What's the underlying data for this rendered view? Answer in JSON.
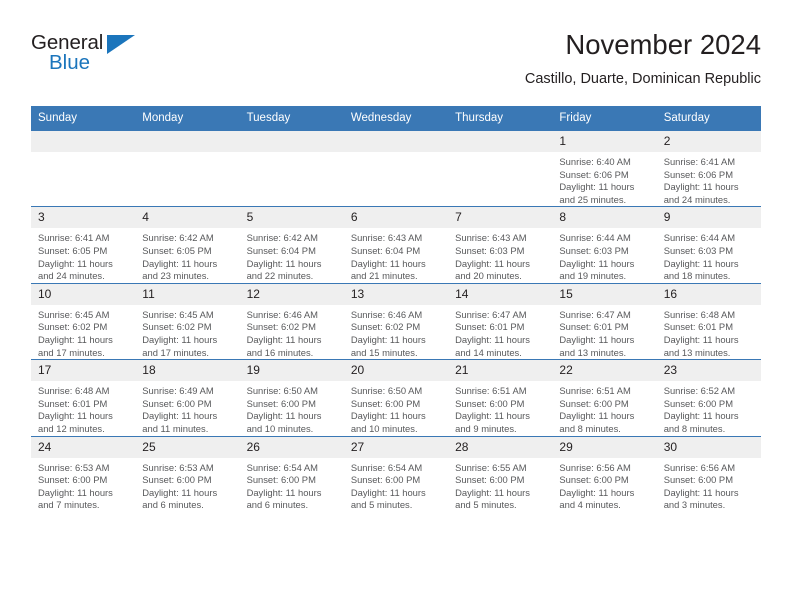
{
  "brand": {
    "name_part1": "General",
    "name_part2": "Blue",
    "triangle_icon": "triangle-icon"
  },
  "header": {
    "title": "November 2024",
    "subtitle": "Castillo, Duarte, Dominican Republic",
    "accent_color": "#3a78b5",
    "brand_blue": "#1b75bc"
  },
  "calendar": {
    "weekday_headers": [
      "Sunday",
      "Monday",
      "Tuesday",
      "Wednesday",
      "Thursday",
      "Friday",
      "Saturday"
    ],
    "weeks": [
      [
        {
          "day": "",
          "info": ""
        },
        {
          "day": "",
          "info": ""
        },
        {
          "day": "",
          "info": ""
        },
        {
          "day": "",
          "info": ""
        },
        {
          "day": "",
          "info": ""
        },
        {
          "day": "1",
          "info": "Sunrise: 6:40 AM\nSunset: 6:06 PM\nDaylight: 11 hours and 25 minutes."
        },
        {
          "day": "2",
          "info": "Sunrise: 6:41 AM\nSunset: 6:06 PM\nDaylight: 11 hours and 24 minutes."
        }
      ],
      [
        {
          "day": "3",
          "info": "Sunrise: 6:41 AM\nSunset: 6:05 PM\nDaylight: 11 hours and 24 minutes."
        },
        {
          "day": "4",
          "info": "Sunrise: 6:42 AM\nSunset: 6:05 PM\nDaylight: 11 hours and 23 minutes."
        },
        {
          "day": "5",
          "info": "Sunrise: 6:42 AM\nSunset: 6:04 PM\nDaylight: 11 hours and 22 minutes."
        },
        {
          "day": "6",
          "info": "Sunrise: 6:43 AM\nSunset: 6:04 PM\nDaylight: 11 hours and 21 minutes."
        },
        {
          "day": "7",
          "info": "Sunrise: 6:43 AM\nSunset: 6:03 PM\nDaylight: 11 hours and 20 minutes."
        },
        {
          "day": "8",
          "info": "Sunrise: 6:44 AM\nSunset: 6:03 PM\nDaylight: 11 hours and 19 minutes."
        },
        {
          "day": "9",
          "info": "Sunrise: 6:44 AM\nSunset: 6:03 PM\nDaylight: 11 hours and 18 minutes."
        }
      ],
      [
        {
          "day": "10",
          "info": "Sunrise: 6:45 AM\nSunset: 6:02 PM\nDaylight: 11 hours and 17 minutes."
        },
        {
          "day": "11",
          "info": "Sunrise: 6:45 AM\nSunset: 6:02 PM\nDaylight: 11 hours and 17 minutes."
        },
        {
          "day": "12",
          "info": "Sunrise: 6:46 AM\nSunset: 6:02 PM\nDaylight: 11 hours and 16 minutes."
        },
        {
          "day": "13",
          "info": "Sunrise: 6:46 AM\nSunset: 6:02 PM\nDaylight: 11 hours and 15 minutes."
        },
        {
          "day": "14",
          "info": "Sunrise: 6:47 AM\nSunset: 6:01 PM\nDaylight: 11 hours and 14 minutes."
        },
        {
          "day": "15",
          "info": "Sunrise: 6:47 AM\nSunset: 6:01 PM\nDaylight: 11 hours and 13 minutes."
        },
        {
          "day": "16",
          "info": "Sunrise: 6:48 AM\nSunset: 6:01 PM\nDaylight: 11 hours and 13 minutes."
        }
      ],
      [
        {
          "day": "17",
          "info": "Sunrise: 6:48 AM\nSunset: 6:01 PM\nDaylight: 11 hours and 12 minutes."
        },
        {
          "day": "18",
          "info": "Sunrise: 6:49 AM\nSunset: 6:00 PM\nDaylight: 11 hours and 11 minutes."
        },
        {
          "day": "19",
          "info": "Sunrise: 6:50 AM\nSunset: 6:00 PM\nDaylight: 11 hours and 10 minutes."
        },
        {
          "day": "20",
          "info": "Sunrise: 6:50 AM\nSunset: 6:00 PM\nDaylight: 11 hours and 10 minutes."
        },
        {
          "day": "21",
          "info": "Sunrise: 6:51 AM\nSunset: 6:00 PM\nDaylight: 11 hours and 9 minutes."
        },
        {
          "day": "22",
          "info": "Sunrise: 6:51 AM\nSunset: 6:00 PM\nDaylight: 11 hours and 8 minutes."
        },
        {
          "day": "23",
          "info": "Sunrise: 6:52 AM\nSunset: 6:00 PM\nDaylight: 11 hours and 8 minutes."
        }
      ],
      [
        {
          "day": "24",
          "info": "Sunrise: 6:53 AM\nSunset: 6:00 PM\nDaylight: 11 hours and 7 minutes."
        },
        {
          "day": "25",
          "info": "Sunrise: 6:53 AM\nSunset: 6:00 PM\nDaylight: 11 hours and 6 minutes."
        },
        {
          "day": "26",
          "info": "Sunrise: 6:54 AM\nSunset: 6:00 PM\nDaylight: 11 hours and 6 minutes."
        },
        {
          "day": "27",
          "info": "Sunrise: 6:54 AM\nSunset: 6:00 PM\nDaylight: 11 hours and 5 minutes."
        },
        {
          "day": "28",
          "info": "Sunrise: 6:55 AM\nSunset: 6:00 PM\nDaylight: 11 hours and 5 minutes."
        },
        {
          "day": "29",
          "info": "Sunrise: 6:56 AM\nSunset: 6:00 PM\nDaylight: 11 hours and 4 minutes."
        },
        {
          "day": "30",
          "info": "Sunrise: 6:56 AM\nSunset: 6:00 PM\nDaylight: 11 hours and 3 minutes."
        }
      ]
    ]
  }
}
